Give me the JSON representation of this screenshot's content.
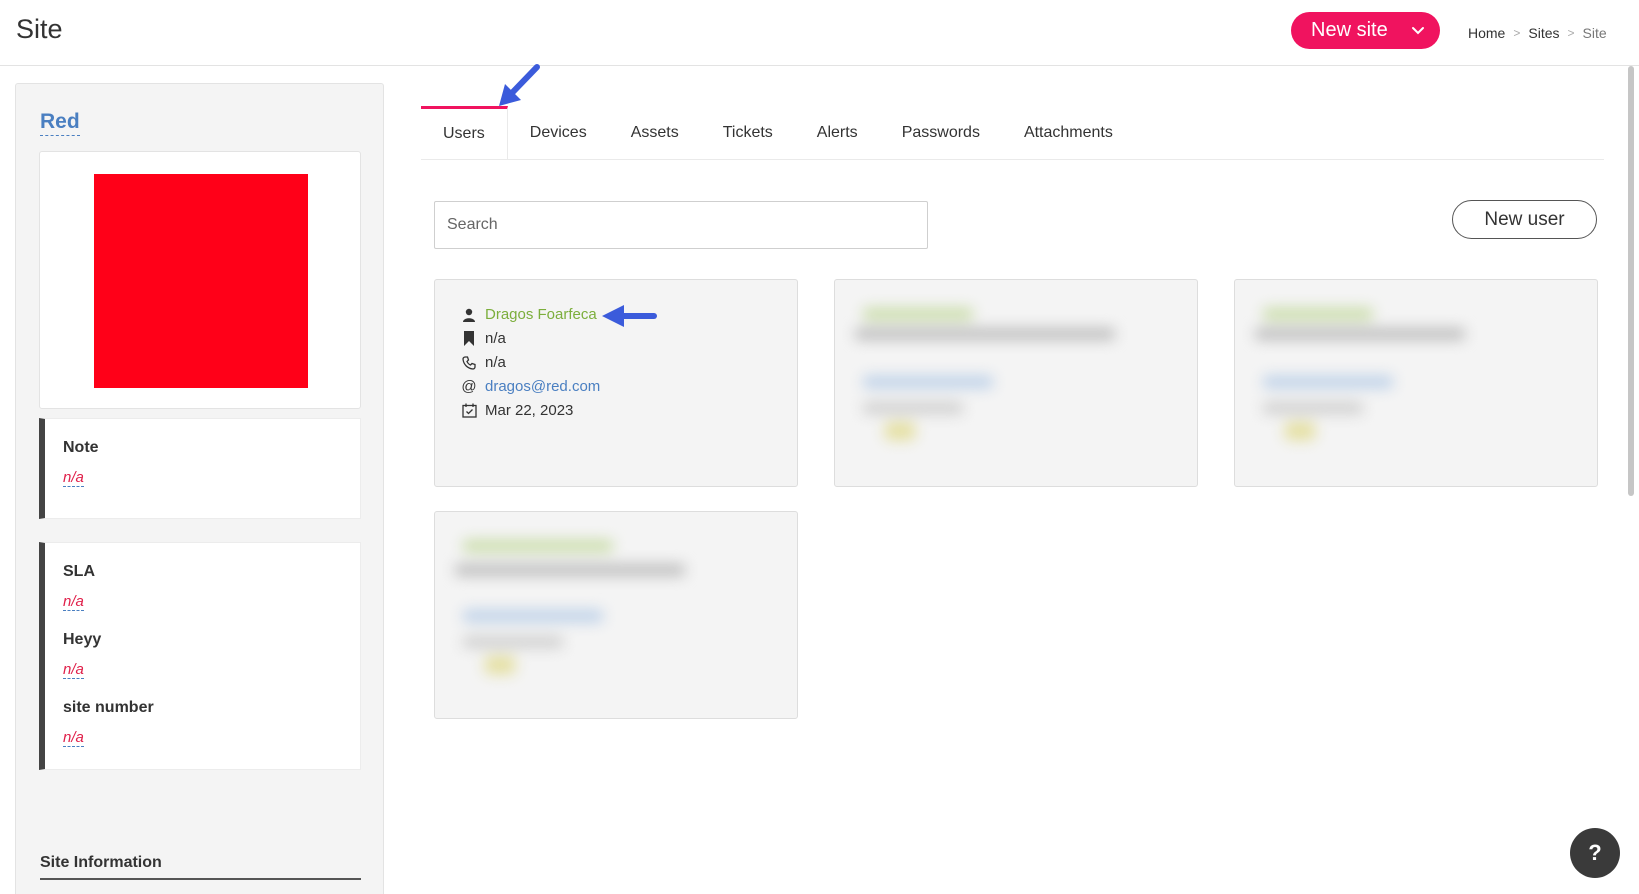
{
  "header": {
    "title": "Site",
    "new_site_label": "New site",
    "breadcrumb": [
      "Home",
      "Sites",
      "Site"
    ],
    "accent_color": "#f0135f"
  },
  "sidebar": {
    "site_name": "Red",
    "logo_color": "#ff0018",
    "note": {
      "label": "Note",
      "value": "n/a"
    },
    "fields": [
      {
        "label": "SLA",
        "value": "n/a"
      },
      {
        "label": "Heyy",
        "value": "n/a"
      },
      {
        "label": "site number",
        "value": "n/a"
      }
    ],
    "site_information_heading": "Site Information"
  },
  "tabs": [
    "Users",
    "Devices",
    "Assets",
    "Tickets",
    "Alerts",
    "Passwords",
    "Attachments"
  ],
  "active_tab": "Users",
  "search": {
    "placeholder": "Search",
    "value": ""
  },
  "new_user_label": "New user",
  "users": [
    {
      "name": "Dragos Foarfeca",
      "title": "n/a",
      "phone": "n/a",
      "email": "dragos@red.com",
      "date": "Mar 22, 2023"
    }
  ],
  "blurred_user_cards": 3,
  "help_label": "?"
}
